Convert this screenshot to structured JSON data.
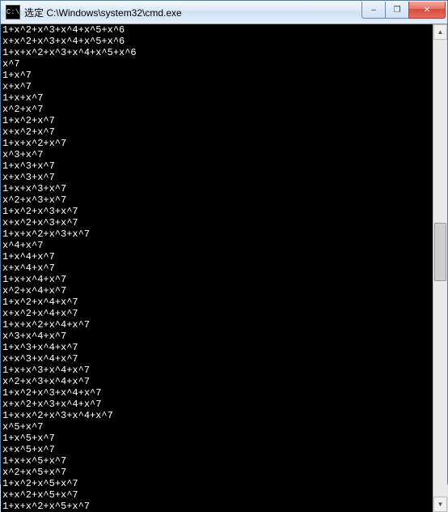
{
  "window": {
    "title": "选定 C:\\Windows\\system32\\cmd.exe",
    "icon_label": "C:\\"
  },
  "buttons": {
    "minimize": "–",
    "maximize": "❐",
    "close": "✕",
    "scroll_up": "▲",
    "scroll_down": "▼"
  },
  "console_lines": [
    "1+x^2+x^3+x^4+x^5+x^6",
    "x+x^2+x^3+x^4+x^5+x^6",
    "1+x+x^2+x^3+x^4+x^5+x^6",
    "x^7",
    "1+x^7",
    "x+x^7",
    "1+x+x^7",
    "x^2+x^7",
    "1+x^2+x^7",
    "x+x^2+x^7",
    "1+x+x^2+x^7",
    "x^3+x^7",
    "1+x^3+x^7",
    "x+x^3+x^7",
    "1+x+x^3+x^7",
    "x^2+x^3+x^7",
    "1+x^2+x^3+x^7",
    "x+x^2+x^3+x^7",
    "1+x+x^2+x^3+x^7",
    "x^4+x^7",
    "1+x^4+x^7",
    "x+x^4+x^7",
    "1+x+x^4+x^7",
    "x^2+x^4+x^7",
    "1+x^2+x^4+x^7",
    "x+x^2+x^4+x^7",
    "1+x+x^2+x^4+x^7",
    "x^3+x^4+x^7",
    "1+x^3+x^4+x^7",
    "x+x^3+x^4+x^7",
    "1+x+x^3+x^4+x^7",
    "x^2+x^3+x^4+x^7",
    "1+x^2+x^3+x^4+x^7",
    "x+x^2+x^3+x^4+x^7",
    "1+x+x^2+x^3+x^4+x^7",
    "x^5+x^7",
    "1+x^5+x^7",
    "x+x^5+x^7",
    "1+x+x^5+x^7",
    "x^2+x^5+x^7",
    "1+x^2+x^5+x^7",
    "x+x^2+x^5+x^7",
    "1+x+x^2+x^5+x^7"
  ]
}
